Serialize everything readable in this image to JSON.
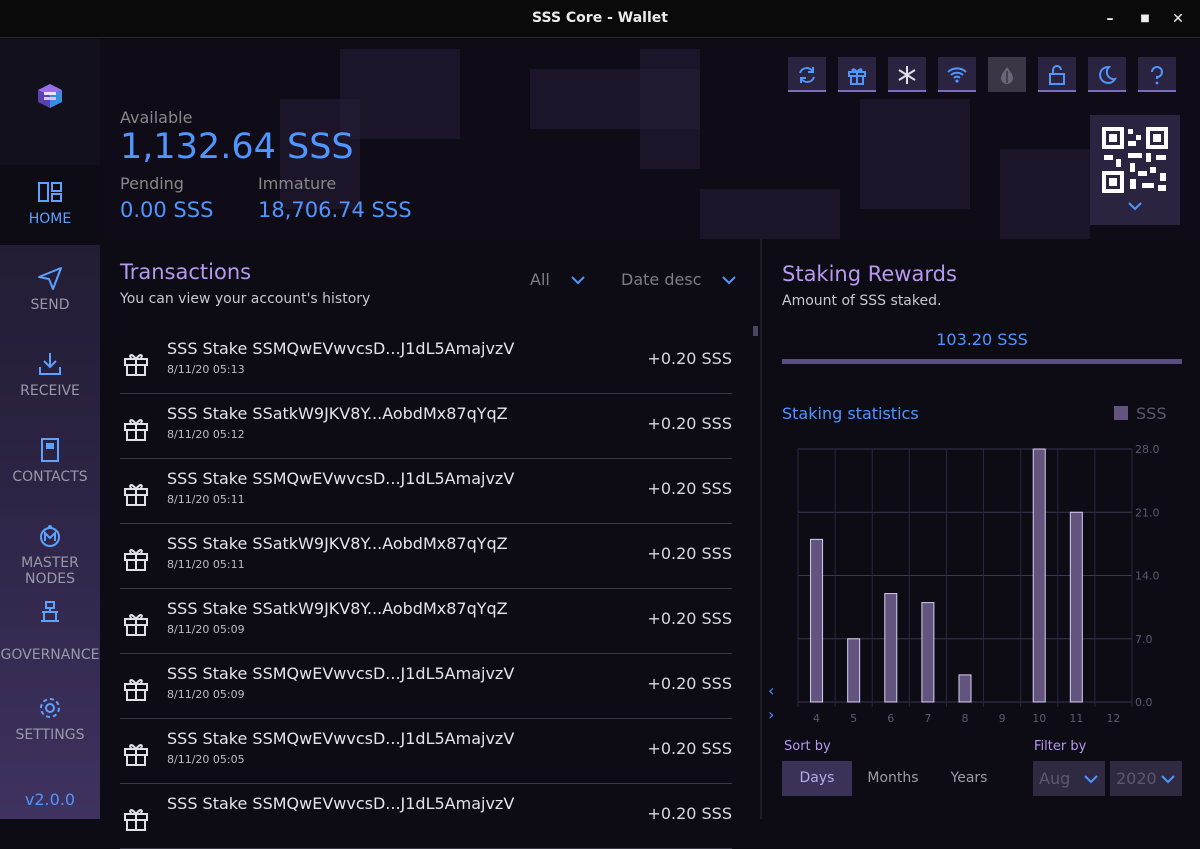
{
  "window": {
    "title": "SSS Core - Wallet",
    "minimize": "–",
    "maximize": "■",
    "close": "✕"
  },
  "sidebar": {
    "items": [
      {
        "label": "HOME"
      },
      {
        "label": "SEND"
      },
      {
        "label": "RECEIVE"
      },
      {
        "label": "CONTACTS"
      },
      {
        "label": "MASTER NODES"
      },
      {
        "label": "GOVERNANCE"
      },
      {
        "label": "SETTINGS"
      }
    ],
    "version": "v2.0.0"
  },
  "balance": {
    "available_label": "Available",
    "available_value": "1,132.64 SSS",
    "pending_label": "Pending",
    "pending_value": "0.00 SSS",
    "immature_label": "Immature",
    "immature_value": "18,706.74 SSS"
  },
  "toolbar_icons": [
    "sync-icon",
    "gift-icon",
    "snowflake-icon",
    "wifi-icon",
    "tor-onion-icon",
    "unlock-icon",
    "moon-icon",
    "help-icon"
  ],
  "transactions": {
    "title": "Transactions",
    "subtitle": "You can view your account's history",
    "filter_type": "All",
    "sort": "Date desc",
    "rows": [
      {
        "name": "SSS Stake SSMQwEVwvcsD...J1dL5AmajvzV",
        "date": "8/11/20 05:13",
        "amount": "+0.20 SSS"
      },
      {
        "name": "SSS Stake SSatkW9JKV8Y...AobdMx87qYqZ",
        "date": "8/11/20 05:12",
        "amount": "+0.20 SSS"
      },
      {
        "name": "SSS Stake SSMQwEVwvcsD...J1dL5AmajvzV",
        "date": "8/11/20 05:11",
        "amount": "+0.20 SSS"
      },
      {
        "name": "SSS Stake SSatkW9JKV8Y...AobdMx87qYqZ",
        "date": "8/11/20 05:11",
        "amount": "+0.20 SSS"
      },
      {
        "name": "SSS Stake SSatkW9JKV8Y...AobdMx87qYqZ",
        "date": "8/11/20 05:09",
        "amount": "+0.20 SSS"
      },
      {
        "name": "SSS Stake SSMQwEVwvcsD...J1dL5AmajvzV",
        "date": "8/11/20 05:09",
        "amount": "+0.20 SSS"
      },
      {
        "name": "SSS Stake SSMQwEVwvcsD...J1dL5AmajvzV",
        "date": "8/11/20 05:05",
        "amount": "+0.20 SSS"
      },
      {
        "name": "SSS Stake SSMQwEVwvcsD...J1dL5AmajvzV",
        "date": "",
        "amount": "+0.20 SSS"
      }
    ]
  },
  "staking": {
    "title": "Staking Rewards",
    "subtitle": "Amount of SSS staked.",
    "amount": "103.20 SSS",
    "stats_title": "Staking statistics",
    "sort_label": "Sort by",
    "filter_label": "Filter by",
    "sort_options": [
      "Days",
      "Months",
      "Years"
    ],
    "selected_sort": "Days",
    "month": "Aug",
    "year": "2020",
    "nav_prev": "‹",
    "nav_next": "›"
  },
  "colors": {
    "accent_blue": "#4f96ff",
    "accent_purple": "#b899f0",
    "bar_fill": "#62537f"
  },
  "chart_data": {
    "type": "bar",
    "categories": [
      "4",
      "5",
      "6",
      "7",
      "8",
      "9",
      "10",
      "11",
      "12"
    ],
    "series": [
      {
        "name": "SSS",
        "values": [
          18.0,
          7.0,
          12.0,
          11.0,
          3.0,
          0.0,
          28.0,
          21.0,
          0.0
        ]
      }
    ],
    "yticks": [
      "28.0",
      "21.0",
      "14.0",
      "7.0",
      "0.0"
    ],
    "ylim": [
      0,
      28
    ],
    "grid": true,
    "legend": "top-right"
  }
}
